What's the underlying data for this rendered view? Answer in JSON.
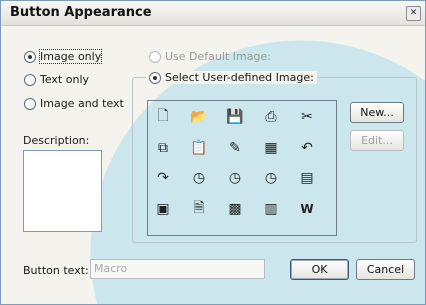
{
  "window": {
    "title": "Button Appearance",
    "close_label": "✕"
  },
  "image_options": [
    {
      "label": "Image only",
      "checked": true
    },
    {
      "label": "Text only",
      "checked": false
    },
    {
      "label": "Image and text",
      "checked": false
    }
  ],
  "source_options": [
    {
      "label": "Use Default Image:",
      "checked": false,
      "disabled": true
    },
    {
      "label": "Select User-defined Image:",
      "checked": true,
      "disabled": false
    }
  ],
  "icons": [
    "new-document-icon",
    "open-folder-icon",
    "save-disk-icon",
    "printer-icon",
    "scissors-icon",
    "copy-icon",
    "paste-icon",
    "format-painter-icon",
    "spreadsheet-icon",
    "undo-icon",
    "redo-icon",
    "clock-icon",
    "clock-icon",
    "clock-icon",
    "page-icon",
    "preview-icon",
    "document-icon",
    "chart-icon",
    "word-doc-icon",
    "word-logo-icon"
  ],
  "buttons": {
    "new": "New...",
    "edit": "Edit...",
    "ok": "OK",
    "cancel": "Cancel"
  },
  "description": {
    "label": "Description:",
    "value": ""
  },
  "button_text": {
    "label": "Button text:",
    "value": "Macro"
  }
}
